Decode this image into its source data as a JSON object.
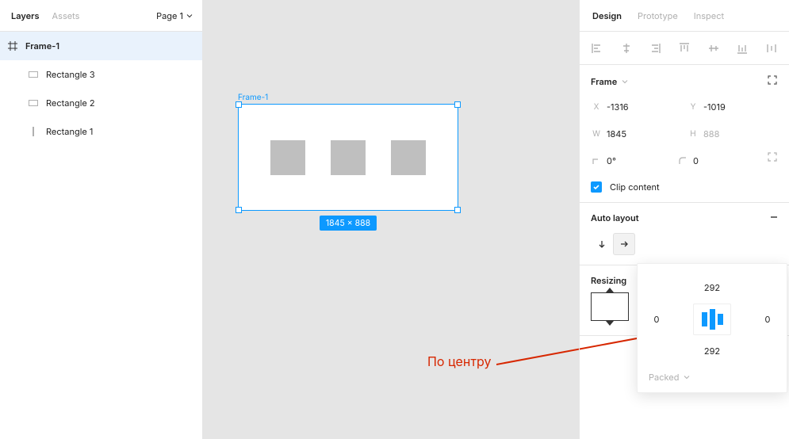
{
  "left_panel": {
    "tabs": {
      "layers": "Layers",
      "assets": "Assets"
    },
    "page_label": "Page 1",
    "layers": {
      "frame": "Frame-1",
      "children": [
        "Rectangle 3",
        "Rectangle 2",
        "Rectangle 1"
      ]
    }
  },
  "canvas": {
    "frame_label": "Frame-1",
    "dimensions_badge": "1845 × 888"
  },
  "annotation": {
    "text": "По центру"
  },
  "right_panel": {
    "tabs": {
      "design": "Design",
      "prototype": "Prototype",
      "inspect": "Inspect"
    },
    "frame_section": {
      "title": "Frame",
      "x_label": "X",
      "x_value": "-1316",
      "y_label": "Y",
      "y_value": "-1019",
      "w_label": "W",
      "w_value": "1845",
      "h_label": "H",
      "h_value": "888",
      "rotation_value": "0°",
      "radius_value": "0",
      "clip_label": "Clip content"
    },
    "auto_layout": {
      "title": "Auto layout"
    },
    "resizing": {
      "title": "Resizing"
    },
    "padding_popover": {
      "top": "292",
      "left": "0",
      "right": "0",
      "bottom": "292",
      "packed": "Packed"
    }
  }
}
